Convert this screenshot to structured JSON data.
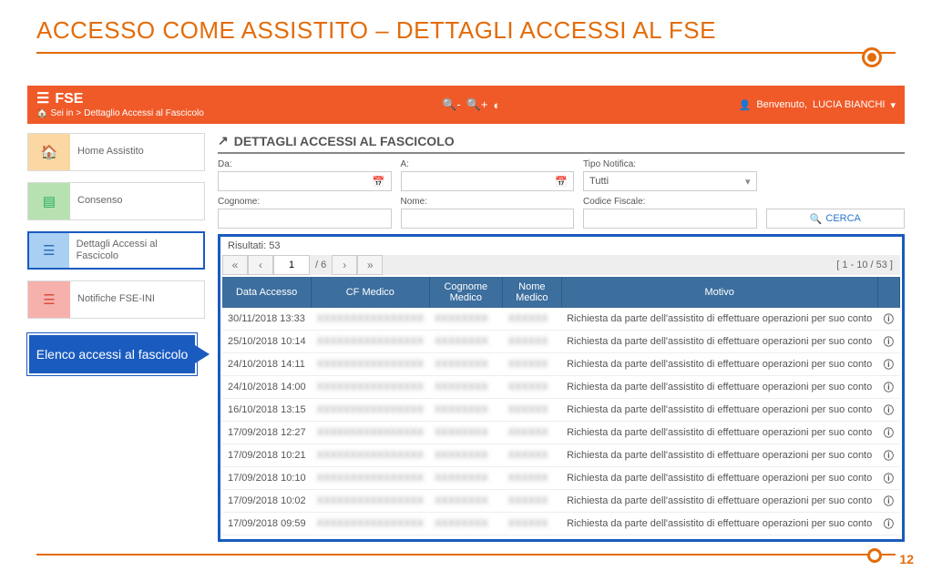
{
  "slide": {
    "title": "ACCESSO COME ASSISTITO – DETTAGLI ACCESSI AL FSE",
    "page_number": "12"
  },
  "topbar": {
    "brand": "FSE",
    "breadcrumb_prefix": "Sei in >",
    "breadcrumb_current": "Dettaglio Accessi al Fascicolo",
    "welcome_prefix": "Benvenuto,",
    "welcome_user": "LUCIA BIANCHI"
  },
  "sidebar": {
    "items": [
      {
        "label": "Home Assistito"
      },
      {
        "label": "Consenso"
      },
      {
        "label": "Dettagli Accessi al Fascicolo"
      },
      {
        "label": "Notifiche FSE-INI"
      }
    ]
  },
  "callout": {
    "text": "Elenco accessi al fascicolo"
  },
  "panel": {
    "title": "DETTAGLI ACCESSI AL FASCICOLO"
  },
  "filters": {
    "da_label": "Da:",
    "a_label": "A:",
    "tipo_label": "Tipo Notifica:",
    "tipo_value": "Tutti",
    "cognome_label": "Cognome:",
    "nome_label": "Nome:",
    "cf_label": "Codice Fiscale:",
    "cerca_label": "CERCA"
  },
  "results": {
    "count_label": "Risultati: 53",
    "page_current": "1",
    "page_total": "/ 6",
    "page_range": "[ 1 - 10 / 53 ]",
    "columns": {
      "data": "Data Accesso",
      "cf": "CF Medico",
      "cognome": "Cognome Medico",
      "nome": "Nome Medico",
      "motivo": "Motivo"
    },
    "motivo_text": "Richiesta da parte dell'assistito di effettuare operazioni per suo conto",
    "rows": [
      {
        "data": "30/11/2018 13:33"
      },
      {
        "data": "25/10/2018 10:14"
      },
      {
        "data": "24/10/2018 14:11"
      },
      {
        "data": "24/10/2018 14:00"
      },
      {
        "data": "16/10/2018 13:15"
      },
      {
        "data": "17/09/2018 12:27"
      },
      {
        "data": "17/09/2018 10:21"
      },
      {
        "data": "17/09/2018 10:10"
      },
      {
        "data": "17/09/2018 10:02"
      },
      {
        "data": "17/09/2018 09:59"
      }
    ]
  }
}
